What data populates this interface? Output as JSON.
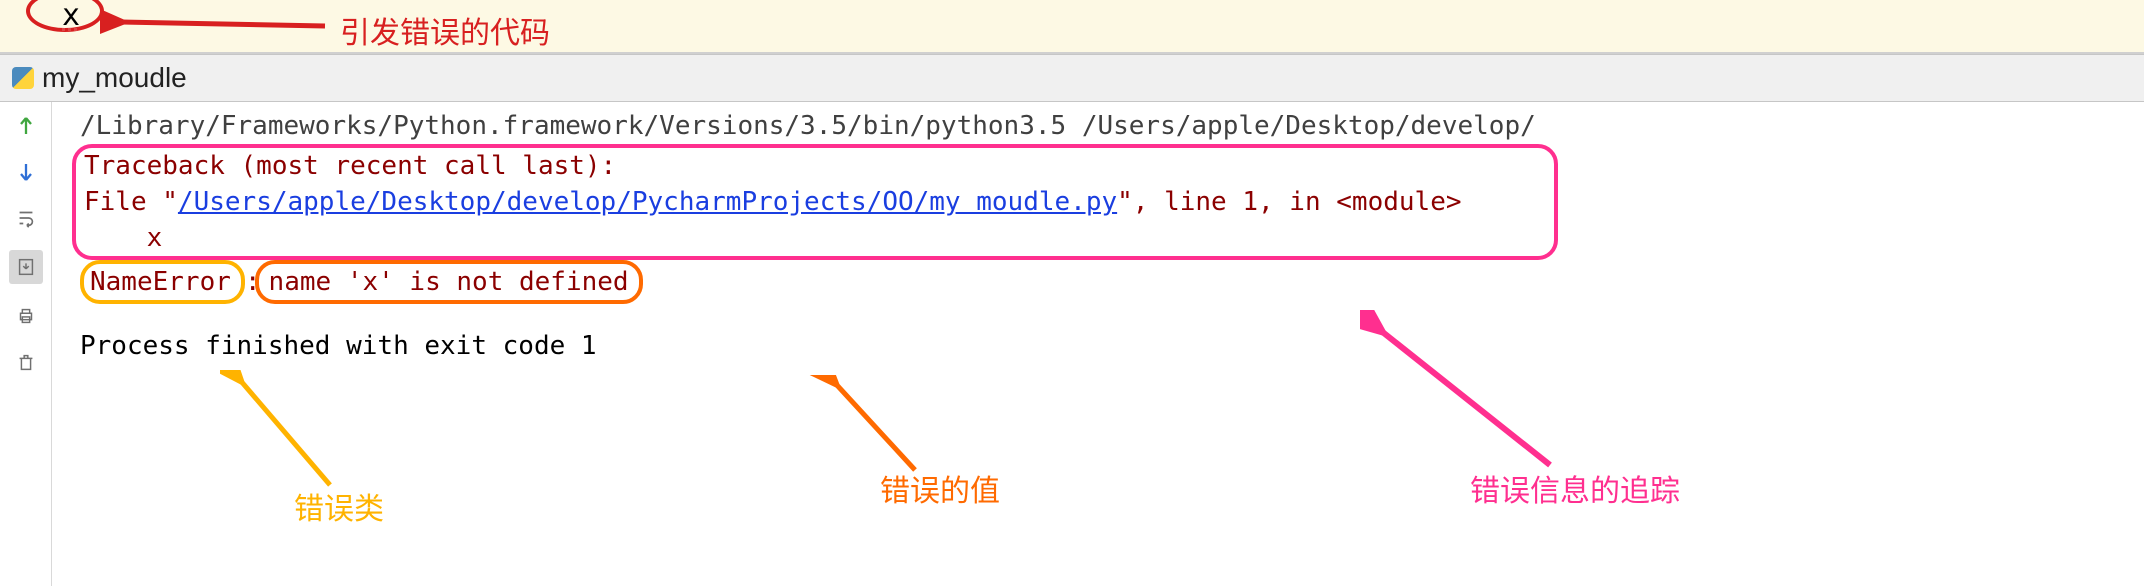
{
  "editor": {
    "code_char": "x"
  },
  "run": {
    "title": "my_moudle"
  },
  "console": {
    "interpreter_line": "/Library/Frameworks/Python.framework/Versions/3.5/bin/python3.5 /Users/apple/Desktop/develop/",
    "traceback_header": "Traceback (most recent call last):",
    "file_prefix": "  File \"",
    "file_path": "/Users/apple/Desktop/develop/PycharmProjects/OO/my moudle.py",
    "file_suffix": "\", line 1, in <module>",
    "code_indent": "    x",
    "error_type": "NameError",
    "colon": ":",
    "error_value": " name 'x' is not defined",
    "exit_line": "Process finished with exit code 1"
  },
  "annotations": {
    "cause": "引发错误的代码",
    "err_class": "错误类",
    "err_value": "错误的值",
    "trace": "错误信息的追踪"
  }
}
